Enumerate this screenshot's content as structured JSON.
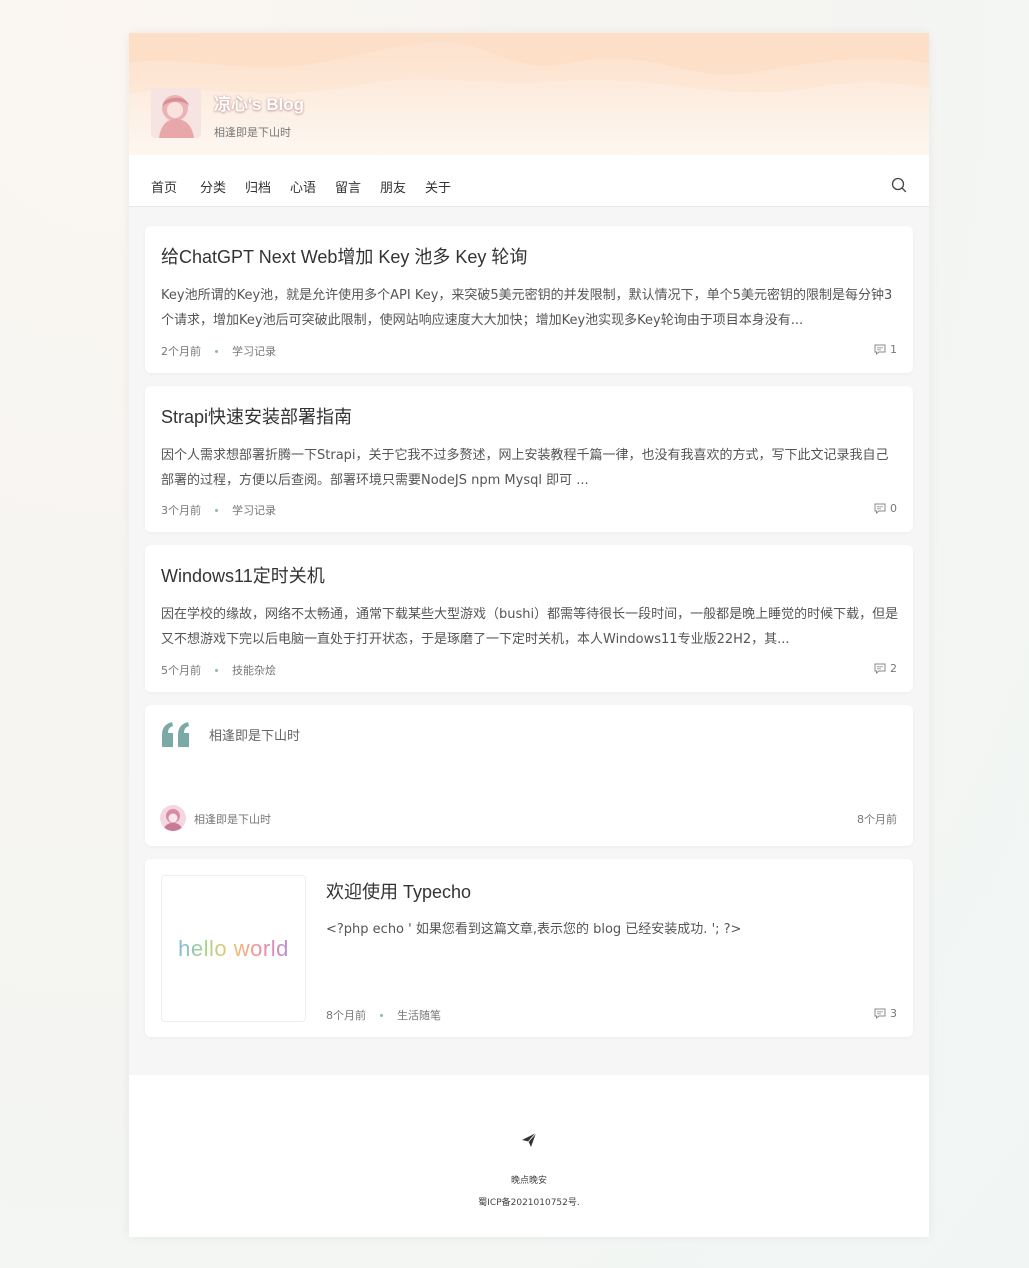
{
  "blog": {
    "title": "凉心's Blog",
    "subtitle": "相逢即是下山时"
  },
  "nav": {
    "items": [
      "首页",
      "分类",
      "归档",
      "心语",
      "留言",
      "朋友",
      "关于"
    ],
    "search_icon": "search-icon"
  },
  "posts": [
    {
      "title": "给ChatGPT Next Web增加 Key 池多 Key 轮询",
      "excerpt": "Key池所谓的Key池，就是允许使用多个API Key，来突破5美元密钥的并发限制，默认情况下，单个5美元密钥的限制是每分钟3个请求，增加Key池后可突破此限制，使网站响应速度大大加快；增加Key池实现多Key轮询由于项目本身没有...",
      "time": "2个月前",
      "category": "学习记录",
      "comments": "1"
    },
    {
      "title": "Strapi快速安装部署指南",
      "excerpt": "因个人需求想部署折腾一下Strapi，关于它我不过多赘述，网上安装教程千篇一律，也没有我喜欢的方式，写下此文记录我自己部署的过程，方便以后查阅。部署环境只需要NodeJS npm Mysql 即可 ...",
      "time": "3个月前",
      "category": "学习记录",
      "comments": "0"
    },
    {
      "title": "Windows11定时关机",
      "excerpt": "因在学校的缘故，网络不太畅通，通常下载某些大型游戏（bushi）都需等待很长一段时间，一般都是晚上睡觉的时候下载，但是又不想游戏下完以后电脑一直处于打开状态，于是琢磨了一下定时关机，本人Windows11专业版22H2，其...",
      "time": "5个月前",
      "category": "技能杂烩",
      "comments": "2"
    }
  ],
  "quote": {
    "text": "相逢即是下山时",
    "author": "相逢即是下山时",
    "time": "8个月前"
  },
  "featured": {
    "thumb_text": "hello world",
    "title": "欢迎使用 Typecho",
    "excerpt": "<?php echo ' 如果您看到这篇文章,表示您的 blog 已经安装成功. '; ?>",
    "time": "8个月前",
    "category": "生活随笔",
    "comments": "3"
  },
  "footer": {
    "line1": "晚点晚安",
    "line2": "蜀ICP备2021010752号."
  },
  "colors": {
    "accent": "#7aa9a6",
    "banner": "#fde3cf"
  }
}
